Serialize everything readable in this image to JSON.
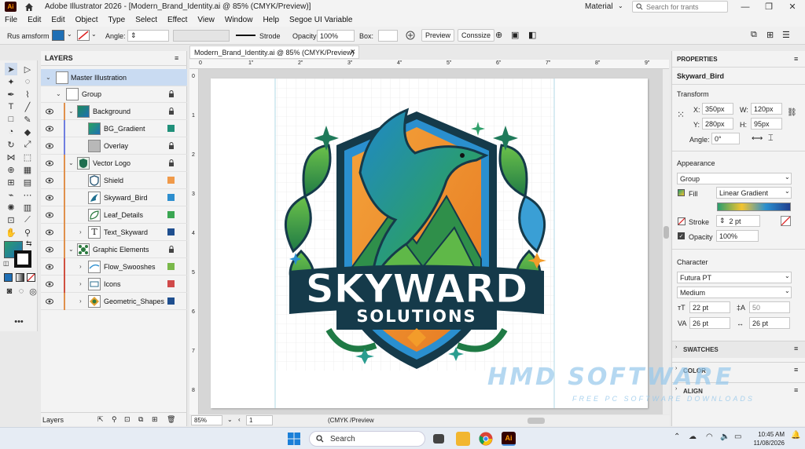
{
  "titlebar": {
    "app_title": "Adobe Illustrator 2026 - [Modern_Brand_Identity.ai @ 85% (CMYK/Preview)]",
    "logo": "Ai",
    "workspace": "Material",
    "search_placeholder": "Search for trants"
  },
  "menu": [
    "File",
    "Edit",
    "Edit",
    "Object",
    "Type",
    "Select",
    "Effect",
    "View",
    "Window",
    "Help",
    "Segoe UI Variable"
  ],
  "control": {
    "selection_label": "Rus amsform",
    "angle_label": "Angle:",
    "stroke_label": "Strode",
    "opacity_label": "Opacity:",
    "opacity_value": "100%",
    "box_label": "Box:",
    "preview_label": "Preview",
    "conssize_label": "Conssize"
  },
  "layers": {
    "tab": "LAYERS",
    "footer_label": "Layers",
    "rows": [
      {
        "name": "Master Illustration",
        "selected": true
      },
      {
        "name": "Group"
      },
      {
        "name": "Background"
      },
      {
        "name": "BG_Gradient"
      },
      {
        "name": "Overlay"
      },
      {
        "name": "Vector Logo"
      },
      {
        "name": "Shield"
      },
      {
        "name": "Skyward_Bird"
      },
      {
        "name": "Leaf_Details"
      },
      {
        "name": "Text_Skyward"
      },
      {
        "name": "Graphic Elements"
      },
      {
        "name": "Flow_Swooshes"
      },
      {
        "name": "Icons"
      },
      {
        "name": "Geometric_Shapes"
      }
    ]
  },
  "document": {
    "tab": "Modern_Brand_Identity.ai @ 85% (CMYK/Preview)",
    "zoom": "85%",
    "page": "1",
    "mode": "(CMYK /Preview",
    "ruler_top": [
      "0",
      "1\"",
      "2\"",
      "3\"",
      "4\"",
      "5\"",
      "6\"",
      "7\"",
      "8\"",
      "9\""
    ],
    "ruler_left": [
      "0",
      "1",
      "2",
      "3",
      "4",
      "5",
      "6",
      "7",
      "8"
    ]
  },
  "logo_art": {
    "line1": "SKYWARD",
    "line2": "SOLUTIONS"
  },
  "properties": {
    "tab": "PROPERTIES",
    "object_name": "Skyward_Bird",
    "transform_title": "Transform",
    "x_label": "X:",
    "x_value": "350px",
    "y_label": "Y:",
    "y_value": "280px",
    "w_label": "W:",
    "w_value": "120px",
    "h_label": "H:",
    "h_value": "95px",
    "angle_label": "Angle:",
    "angle_value": "0°",
    "appearance_title": "Appearance",
    "group_value": "Group",
    "fill_label": "Fill",
    "fill_value": "Linear Gradient",
    "stroke_label": "Stroke",
    "stroke_value": "2 pt",
    "opacity_label": "Opacity",
    "opacity_value": "100%",
    "character_title": "Character",
    "font_family": "Futura PT",
    "font_style": "Medium",
    "font_size": "22 pt",
    "leading": "50",
    "tracking": "26 pt",
    "kerning": "26 pt",
    "swatches": "SWATCHES",
    "color": "COLOR",
    "align": "ALIGN"
  },
  "watermark": {
    "main": "HMD SOFTWARE",
    "sub": "FREE PC SOFTWARE DOWNLOADS"
  },
  "taskbar": {
    "search": "Search",
    "time": "10:45 AM",
    "date": "11/08/2026"
  },
  "colors": {
    "accent_blue": "#1f6fb5",
    "selected_row": "#c9dbf2",
    "ai_orange": "#ff9a00"
  }
}
